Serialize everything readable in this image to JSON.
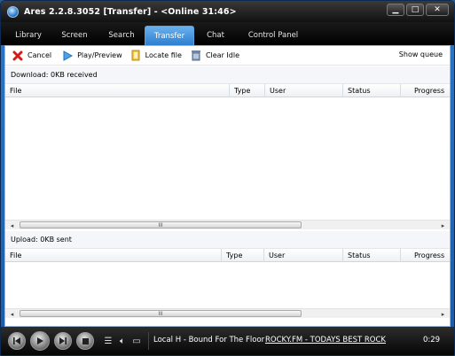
{
  "window": {
    "title": "Ares 2.2.8.3052   [Transfer]   -  <Online 31:46>",
    "buttons": {
      "minimize": "▁",
      "maximize": "□",
      "close": "✕"
    }
  },
  "nav": {
    "tabs": [
      {
        "label": "Library"
      },
      {
        "label": "Screen"
      },
      {
        "label": "Search"
      },
      {
        "label": "Transfer",
        "active": true
      },
      {
        "label": "Chat"
      },
      {
        "label": "Control Panel"
      }
    ]
  },
  "toolbar": {
    "cancel": "Cancel",
    "play_preview": "Play/Preview",
    "locate_file": "Locate file",
    "clear_idle": "Clear Idle",
    "show_queue": "Show queue"
  },
  "download": {
    "label": "Download: 0KB received",
    "columns": [
      "File",
      "Type",
      "User",
      "Status",
      "Progress"
    ],
    "scroll_grip": "III"
  },
  "upload": {
    "label": "Upload: 0KB sent",
    "columns": [
      "File",
      "Type",
      "User",
      "Status",
      "Progress"
    ],
    "scroll_grip": "III"
  },
  "player": {
    "song": "Local H - Bound For The Floor",
    "station": "ROCKY.FM - TODAYS BEST ROCK",
    "time": "0:29"
  },
  "icons": {
    "cancel": "red-x-icon",
    "play": "blue-arrow-icon",
    "locate": "folder-icon",
    "clear": "trash-icon"
  },
  "colors": {
    "accent_tab": "#3a8fe0",
    "titlebar": "#111111",
    "window_frame": "#1b5aa6"
  }
}
